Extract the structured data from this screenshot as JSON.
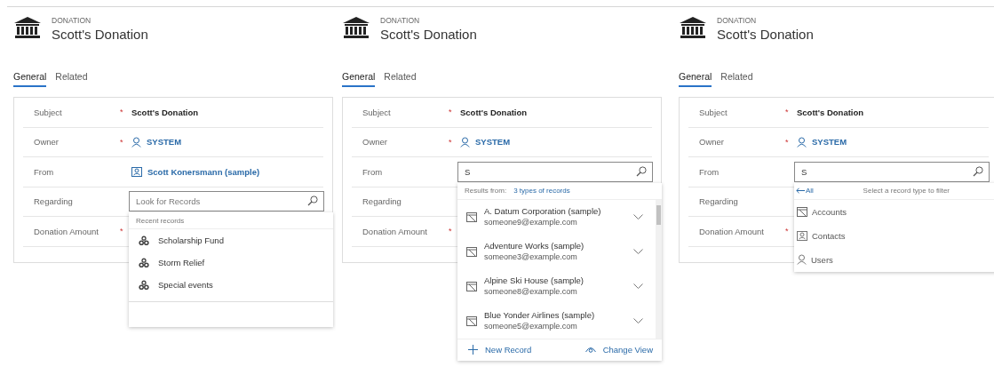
{
  "panels": [
    {
      "header": {
        "entity": "DONATION",
        "title": "Scott's Donation"
      },
      "tabs": [
        {
          "label": "General",
          "selected": true
        },
        {
          "label": "Related",
          "selected": false
        }
      ],
      "fields": [
        {
          "label": "Subject",
          "required_mark": "*",
          "kind": "text",
          "value": "Scott's Donation"
        },
        {
          "label": "Owner",
          "required_mark": "*",
          "kind": "user",
          "value": "SYSTEM"
        },
        {
          "label": "From",
          "kind": "contact",
          "value": "Scott Konersmann (sample)"
        },
        {
          "label": "Regarding",
          "kind": "search",
          "placeholder": "Look for Records",
          "dropdown": {
            "kind": "recent",
            "heading": "Recent records",
            "items": [
              "Scholarship Fund",
              "Storm Relief",
              "Special events"
            ]
          }
        },
        {
          "label": "Donation Amount",
          "required_mark": "*",
          "kind": "empty"
        }
      ]
    },
    {
      "header": {
        "entity": "DONATION",
        "title": "Scott's Donation"
      },
      "tabs": [
        {
          "label": "General",
          "selected": true
        },
        {
          "label": "Related",
          "selected": false
        }
      ],
      "fields": [
        {
          "label": "Subject",
          "required_mark": "*",
          "kind": "text",
          "value": "Scott's Donation"
        },
        {
          "label": "Owner",
          "required_mark": "*",
          "kind": "user",
          "value": "SYSTEM"
        },
        {
          "label": "From",
          "kind": "search",
          "value": "S",
          "dropdown": {
            "kind": "results",
            "heading": "Results from:",
            "link": "3 types of records",
            "items": [
              {
                "name": "A. Datum Corporation (sample)",
                "email": "someone9@example.com"
              },
              {
                "name": "Adventure Works (sample)",
                "email": "someone3@example.com"
              },
              {
                "name": "Alpine Ski House (sample)",
                "email": "someone8@example.com"
              },
              {
                "name": "Blue Yonder Airlines (sample)",
                "email": "someone5@example.com"
              }
            ],
            "actions": [
              {
                "kind": "new",
                "label": "New Record"
              },
              {
                "kind": "view",
                "label": "Change View"
              }
            ]
          }
        },
        {
          "label": "Regarding",
          "kind": "empty"
        },
        {
          "label": "Donation Amount",
          "required_mark": "*",
          "kind": "empty"
        }
      ]
    },
    {
      "header": {
        "entity": "DONATION",
        "title": "Scott's Donation"
      },
      "tabs": [
        {
          "label": "General",
          "selected": true
        },
        {
          "label": "Related",
          "selected": false
        }
      ],
      "fields": [
        {
          "label": "Subject",
          "required_mark": "*",
          "kind": "text",
          "value": "Scott's Donation"
        },
        {
          "label": "Owner",
          "required_mark": "*",
          "kind": "user",
          "value": "SYSTEM"
        },
        {
          "label": "From",
          "kind": "search",
          "value": "S",
          "dropdown": {
            "kind": "types",
            "back": "All",
            "heading": "Select a record type to filter",
            "items": [
              {
                "kind": "account",
                "label": "Accounts"
              },
              {
                "kind": "contact",
                "label": "Contacts"
              },
              {
                "kind": "user",
                "label": "Users"
              }
            ]
          }
        },
        {
          "label": "Regarding",
          "kind": "empty"
        },
        {
          "label": "Donation Amount",
          "required_mark": "*",
          "kind": "empty"
        }
      ]
    }
  ]
}
